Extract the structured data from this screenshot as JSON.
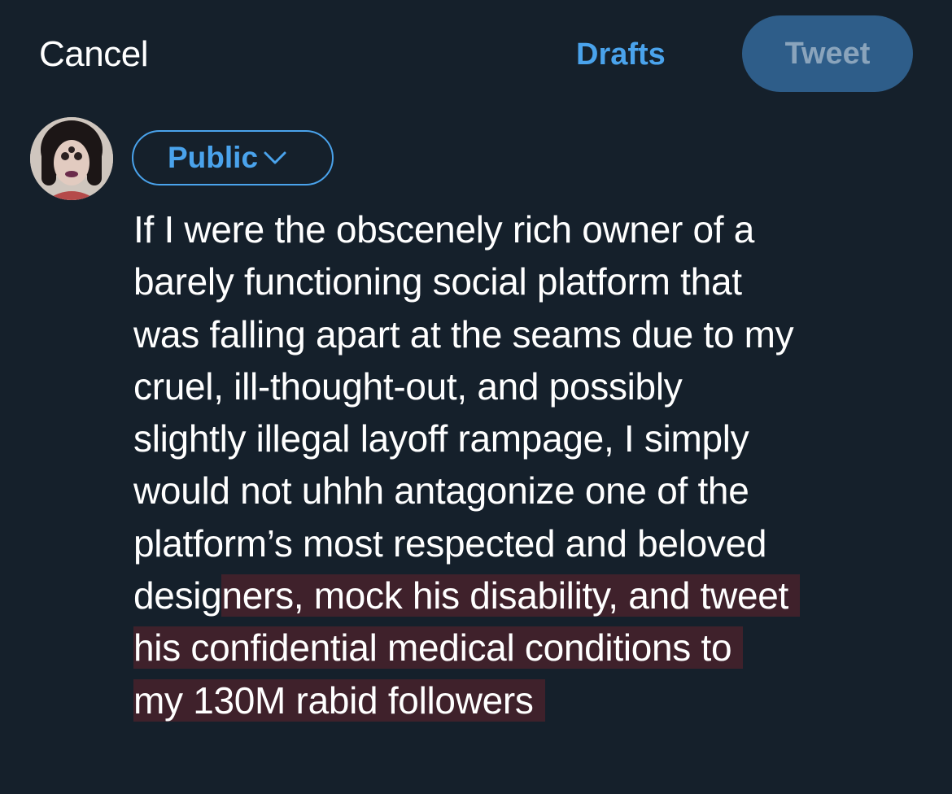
{
  "header": {
    "cancel_label": "Cancel",
    "drafts_label": "Drafts",
    "tweet_label": "Tweet"
  },
  "composer": {
    "audience_label": "Public",
    "audience_icon": "chevron-down-icon",
    "avatar_icon": "user-avatar",
    "text_lines": [
      "If I were the obscenely rich owner of a",
      "barely functioning social platform that",
      "was falling apart at the seams due to my",
      "cruel, ill-thought-out, and possibly",
      "slightly illegal layoff rampage, I simply",
      "would not uhhh antagonize one of the",
      "platform’s most respected and beloved",
      "desig",
      "ners, mock his disability, and tweet",
      "his confidential medical conditions to",
      "my 130M rabid followers"
    ]
  },
  "colors": {
    "background": "#15202b",
    "accent": "#4aa3ec",
    "tweet_button_bg": "#2e5d89",
    "tweet_button_text": "#8aa4bc",
    "highlight": "#3f212b",
    "text": "#ffffff"
  }
}
